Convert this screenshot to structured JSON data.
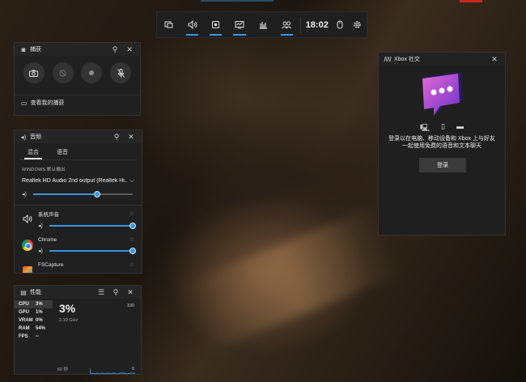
{
  "topbar": {
    "time": "18:02",
    "buttons": [
      "widget-menu-icon",
      "audio-icon",
      "capture-icon",
      "performance-icon",
      "resources-icon",
      "xbox-social-icon",
      "mouse-icon",
      "settings-icon"
    ]
  },
  "capture": {
    "title": "捕获",
    "see_captures": "查看我的捕获"
  },
  "audio": {
    "title": "音频",
    "tabs": [
      "混合",
      "语音"
    ],
    "output_label": "WINDOWS 默认输出",
    "device": "Realtek HD Audio 2nd output (Realtek Hi...",
    "master_level": 0.64,
    "apps": [
      {
        "name": "系统声音",
        "level": 1.0
      },
      {
        "name": "Chrome",
        "level": 1.0
      },
      {
        "name": "FSCapture",
        "level": 1.0
      }
    ]
  },
  "performance": {
    "title": "性能",
    "metrics": [
      {
        "key": "CPU",
        "value": "3%"
      },
      {
        "key": "GPU",
        "value": "1%"
      },
      {
        "key": "VRAM",
        "value": "0%"
      },
      {
        "key": "RAM",
        "value": "54%"
      },
      {
        "key": "FPS",
        "value": "--"
      }
    ],
    "big_value": "3%",
    "sub": "2.10 GHz",
    "max": "100",
    "axis_left": "60 秒",
    "axis_right": "0"
  },
  "xbox": {
    "title": "Xbox 社交",
    "message_line1": "登录以在电脑、移动设备和 Xbox 上与好友",
    "message_line2": "一起使用免费的语音和文本聊天",
    "login_label": "登录"
  },
  "colors": {
    "accent": "#3a96dd",
    "panel": "#202020",
    "xbox_purple": "#a44cd0"
  }
}
